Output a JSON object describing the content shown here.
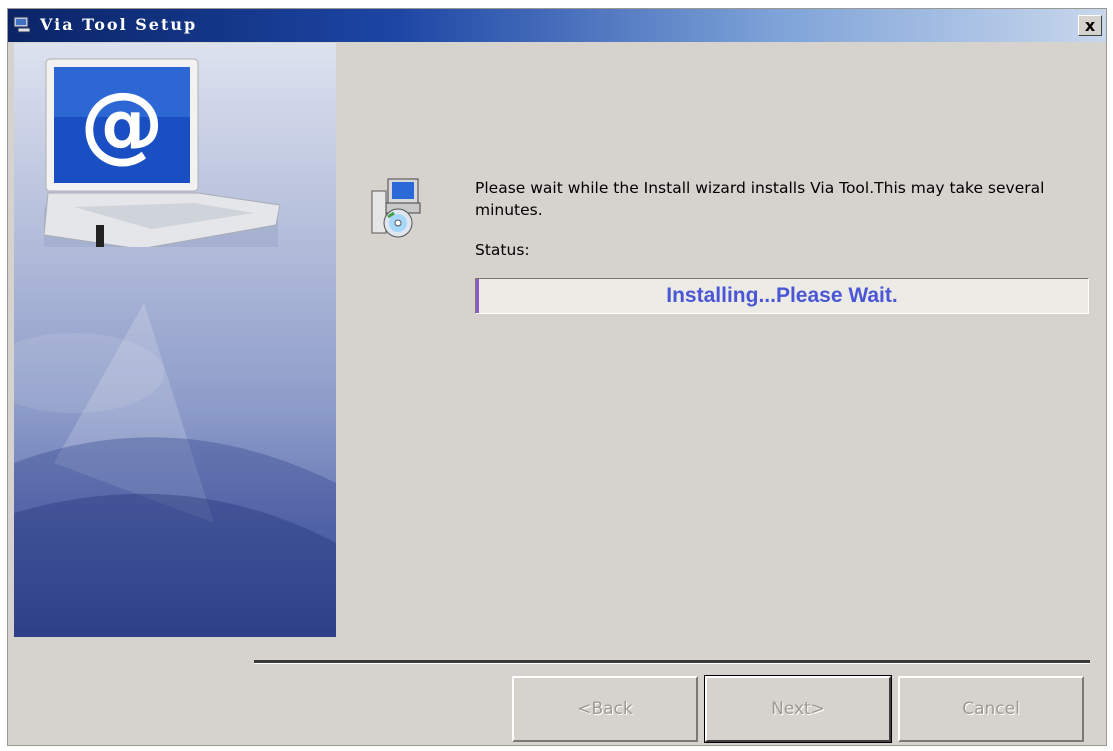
{
  "window": {
    "title": "Via Tool Setup",
    "close_label": "x"
  },
  "content": {
    "message": "Please wait while the Install wizard installs Via Tool.This may take several minutes.",
    "status_label": "Status:",
    "progress_text": "Installing...Please Wait.",
    "progress_value": 0.005
  },
  "buttons": {
    "back": "<Back",
    "next": "Next>",
    "cancel": "Cancel"
  },
  "icons": {
    "app": "setup-app-icon",
    "close": "close-icon",
    "laptop": "laptop-email-icon",
    "setup": "setup-computer-disc-icon"
  },
  "colors": {
    "titlebar_start": "#0a2466",
    "progress_text": "#4a56d6",
    "progress_fill": "#8b5bc7",
    "face": "#d6d3ce"
  }
}
